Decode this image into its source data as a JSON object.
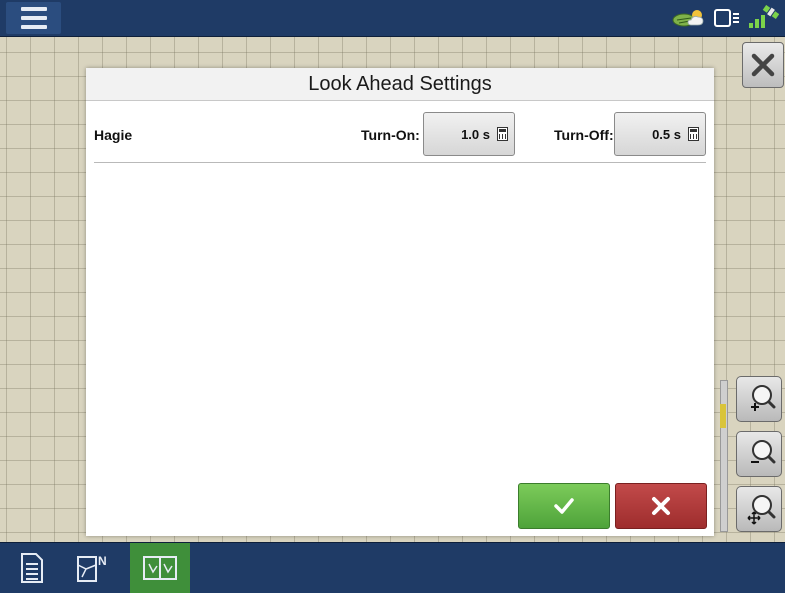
{
  "dialog": {
    "title": "Look Ahead Settings",
    "row": {
      "name": "Hagie",
      "turn_on_label": "Turn-On:",
      "turn_on_value": "1.0 s",
      "turn_off_label": "Turn-Off:",
      "turn_off_value": "0.5 s"
    }
  },
  "icons": {
    "menu": "hamburger-menu-icon",
    "status": [
      "field-weather-icon",
      "display-connection-icon",
      "gps-signal-icon"
    ],
    "close": "close-icon",
    "zoom": [
      "zoom-in-icon",
      "zoom-out-icon",
      "zoom-extents-icon"
    ],
    "ok": "checkmark-icon",
    "cancel": "x-icon",
    "tabs": [
      "document-icon",
      "field-map-icon",
      "split-view-icon"
    ]
  },
  "colors": {
    "ok": "#4ea33a",
    "cancel": "#9e2d2d",
    "active_tab": "#3f8f3a",
    "bar": "#1f3b66"
  },
  "zoom": {
    "level_fraction": 0.2
  }
}
